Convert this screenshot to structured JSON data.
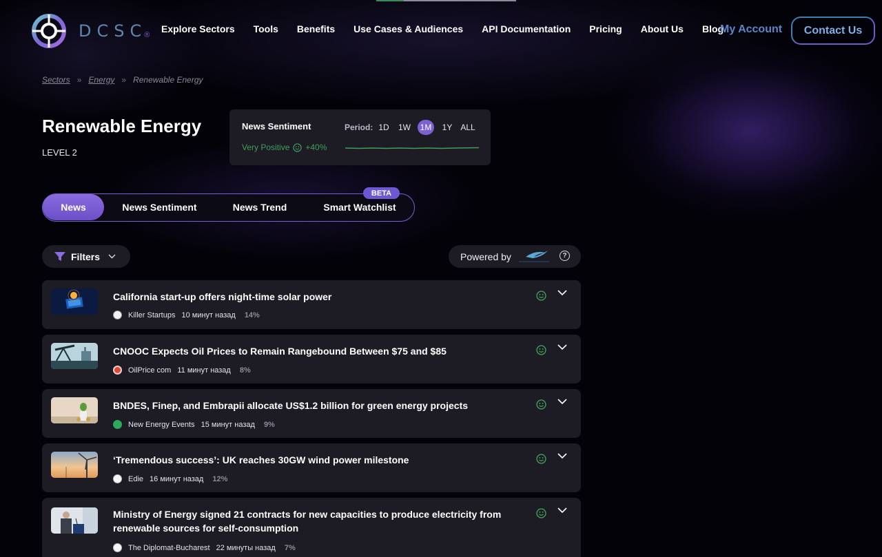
{
  "header": {
    "logo_text": "DCSC",
    "logo_mark": "®",
    "nav": [
      "Explore Sectors",
      "Tools",
      "Benefits",
      "Use Cases & Audiences",
      "API Documentation",
      "Pricing",
      "About Us",
      "Blog"
    ],
    "my_account": "My Account",
    "contact": "Contact Us"
  },
  "breadcrumb": {
    "items": [
      "Sectors",
      "Energy",
      "Renewable Energy"
    ],
    "separator": "»"
  },
  "page": {
    "title": "Renewable Energy",
    "level": "LEVEL 2"
  },
  "sentiment": {
    "title": "News Sentiment",
    "period_label": "Period:",
    "periods": [
      "1D",
      "1W",
      "1M",
      "1Y",
      "ALL"
    ],
    "active_period": "1M",
    "value_label": "Very Positive",
    "value_change": "+40%",
    "color": "#3fa05a"
  },
  "tabs": {
    "items": [
      "News",
      "News Sentiment",
      "News Trend",
      "Smart Watchlist"
    ],
    "active": "News",
    "badge": "BETA"
  },
  "toolbar": {
    "filters_label": "Filters",
    "powered_by_label": "Powered by",
    "help_label": "?"
  },
  "news": [
    {
      "title": "California start-up offers night-time solar power",
      "source": "Killer Startups",
      "time": "10 минут назад",
      "score": "14%",
      "thumb_icon": "solar-chip-image",
      "source_icon": "killer-startups-icon"
    },
    {
      "title": "CNOOC Expects Oil Prices to Remain Rangebound Between $75 and $85",
      "source": "OilPrice com",
      "time": "11 минут назад",
      "score": "8%",
      "thumb_icon": "oil-pump-image",
      "source_icon": "oilprice-icon"
    },
    {
      "title": "BNDES, Finep, and Embrapii allocate US$1.2 billion for green energy projects",
      "source": "New Energy Events",
      "time": "15 минут назад",
      "score": "9%",
      "thumb_icon": "plant-coins-image",
      "source_icon": "new-energy-events-icon"
    },
    {
      "title": "‘Tremendous success’: UK reaches 30GW wind power milestone",
      "source": "Edie",
      "time": "16 минут назад",
      "score": "12%",
      "thumb_icon": "wind-turbine-image",
      "source_icon": "edie-icon"
    },
    {
      "title": "Ministry of Energy signed 21 contracts for new capacities to produce electricity from renewable sources for self-consumption",
      "source": "The Diplomat-Bucharest",
      "time": "22 минуты назад",
      "score": "7%",
      "thumb_icon": "speaker-podium-image",
      "source_icon": "diplomat-icon"
    }
  ]
}
